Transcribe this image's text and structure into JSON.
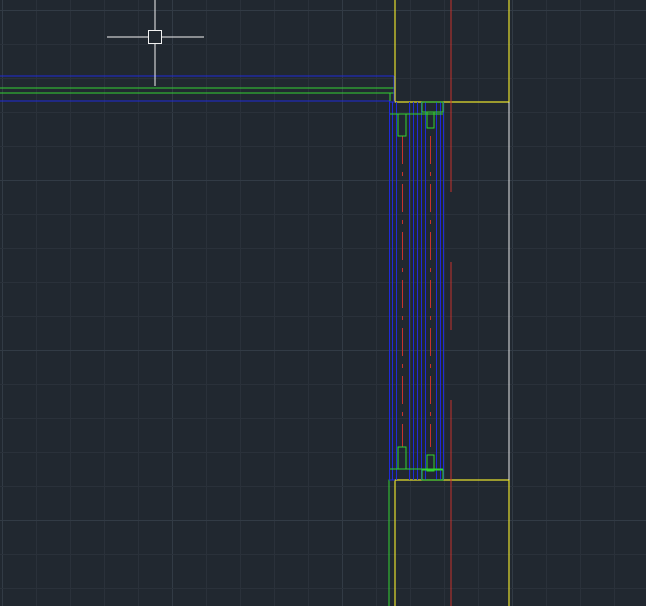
{
  "colors": {
    "background": "#212830",
    "grid_minor": "#2a313a",
    "grid_major": "#323b45",
    "layer_blue": "#1f2ad8",
    "layer_green": "#32d232",
    "layer_yellow": "#e6e02c",
    "layer_red": "#c8322c",
    "layer_white": "#e8e8e8",
    "crosshair": "#f2f2f2"
  },
  "cursor": {
    "icon": "crosshair-pickbox-icon",
    "style": "crosshair"
  },
  "drawing": {
    "layers": [
      "blue-outline",
      "green-frame",
      "yellow-wall",
      "red-centerline",
      "white-edge"
    ]
  }
}
